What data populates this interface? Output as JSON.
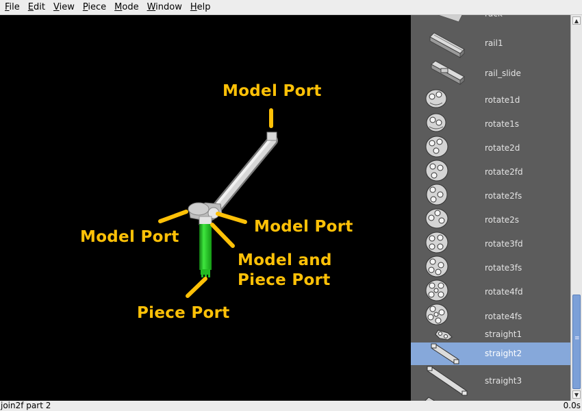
{
  "menu": [
    "File",
    "Edit",
    "View",
    "Piece",
    "Mode",
    "Window",
    "Help"
  ],
  "viewport": {
    "labels": {
      "top": "Model Port",
      "left": "Model Port",
      "right": "Model Port",
      "center_line1": "Model and",
      "center_line2": "Piece Port",
      "bottom": "Piece Port"
    },
    "colors": {
      "label": "#ffc107",
      "active_piece": "#22cc22",
      "background": "#000000"
    }
  },
  "pieces": [
    {
      "name": "rack",
      "icon": "rack-piece-icon",
      "selected": false
    },
    {
      "name": "rail1",
      "icon": "rail-piece-icon",
      "selected": false
    },
    {
      "name": "rail_slide",
      "icon": "rail-piece-icon",
      "selected": false
    },
    {
      "name": "rotate1d",
      "icon": "rotate-piece-icon",
      "selected": false
    },
    {
      "name": "rotate1s",
      "icon": "rotate-piece-icon",
      "selected": false
    },
    {
      "name": "rotate2d",
      "icon": "rotate-piece-icon",
      "selected": false
    },
    {
      "name": "rotate2fd",
      "icon": "rotate-piece-icon",
      "selected": false
    },
    {
      "name": "rotate2fs",
      "icon": "rotate-piece-icon",
      "selected": false
    },
    {
      "name": "rotate2s",
      "icon": "rotate-piece-icon",
      "selected": false
    },
    {
      "name": "rotate3fd",
      "icon": "rotate-piece-icon",
      "selected": false
    },
    {
      "name": "rotate3fs",
      "icon": "rotate-piece-icon",
      "selected": false
    },
    {
      "name": "rotate4fd",
      "icon": "rotate-piece-icon",
      "selected": false
    },
    {
      "name": "rotate4fs",
      "icon": "rotate-piece-icon",
      "selected": false
    },
    {
      "name": "straight1",
      "icon": "straight-piece-icon",
      "selected": false
    },
    {
      "name": "straight2",
      "icon": "straight-piece-icon",
      "selected": true
    },
    {
      "name": "straight3",
      "icon": "straight-piece-icon",
      "selected": false
    }
  ],
  "status": {
    "left": "join2f part 2",
    "right": "0.0s"
  }
}
